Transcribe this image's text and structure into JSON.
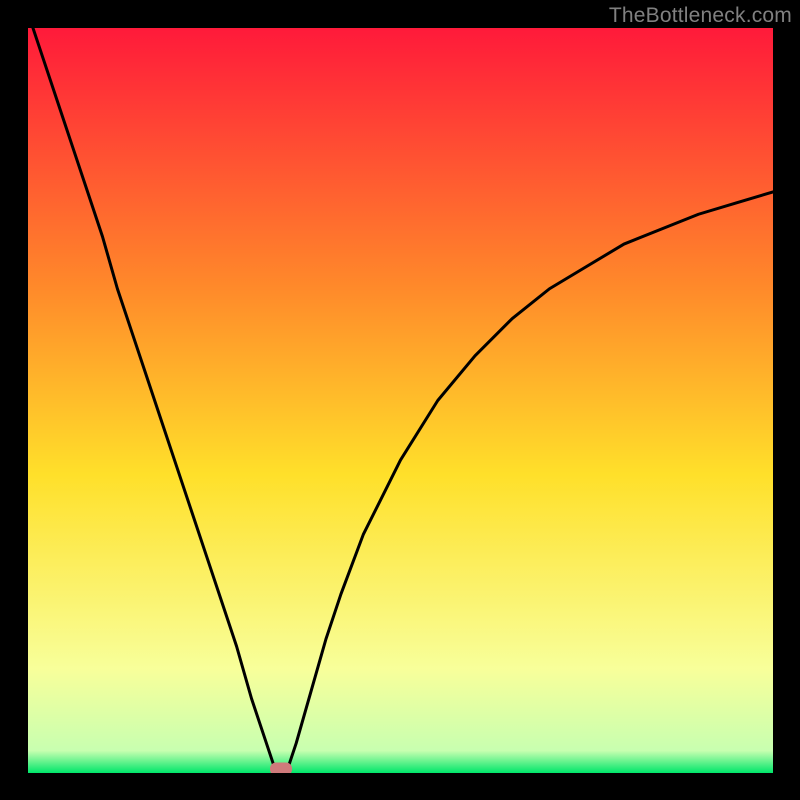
{
  "watermark": "TheBottleneck.com",
  "colors": {
    "top": "#ff1a3a",
    "mid_upper": "#ff8a2a",
    "mid": "#ffe02a",
    "lower": "#f8ff9a",
    "bottom": "#00e66a",
    "curve": "#000000",
    "marker": "#cf7a7b",
    "frame": "#000000"
  },
  "chart_data": {
    "type": "line",
    "title": "",
    "xlabel": "",
    "ylabel": "",
    "xlim": [
      0,
      100
    ],
    "ylim": [
      0,
      100
    ],
    "grid": false,
    "legend": false,
    "series": [
      {
        "name": "bottleneck-curve",
        "x": [
          0,
          2,
          4,
          6,
          8,
          10,
          12,
          14,
          16,
          18,
          20,
          22,
          24,
          26,
          28,
          30,
          32,
          33,
          34,
          35,
          36,
          38,
          40,
          42,
          45,
          50,
          55,
          60,
          65,
          70,
          75,
          80,
          85,
          90,
          95,
          100
        ],
        "y": [
          102,
          96,
          90,
          84,
          78,
          72,
          65,
          59,
          53,
          47,
          41,
          35,
          29,
          23,
          17,
          10,
          4,
          1,
          0,
          1,
          4,
          11,
          18,
          24,
          32,
          42,
          50,
          56,
          61,
          65,
          68,
          71,
          73,
          75,
          76.5,
          78
        ]
      }
    ],
    "marker": {
      "x": 34,
      "y": 0.6
    },
    "gradient_stops": [
      {
        "pos": 0,
        "color": "#ff1a3a"
      },
      {
        "pos": 35,
        "color": "#ff8a2a"
      },
      {
        "pos": 60,
        "color": "#ffe02a"
      },
      {
        "pos": 86,
        "color": "#f8ff9a"
      },
      {
        "pos": 97,
        "color": "#c8ffb0"
      },
      {
        "pos": 100,
        "color": "#00e66a"
      }
    ]
  }
}
